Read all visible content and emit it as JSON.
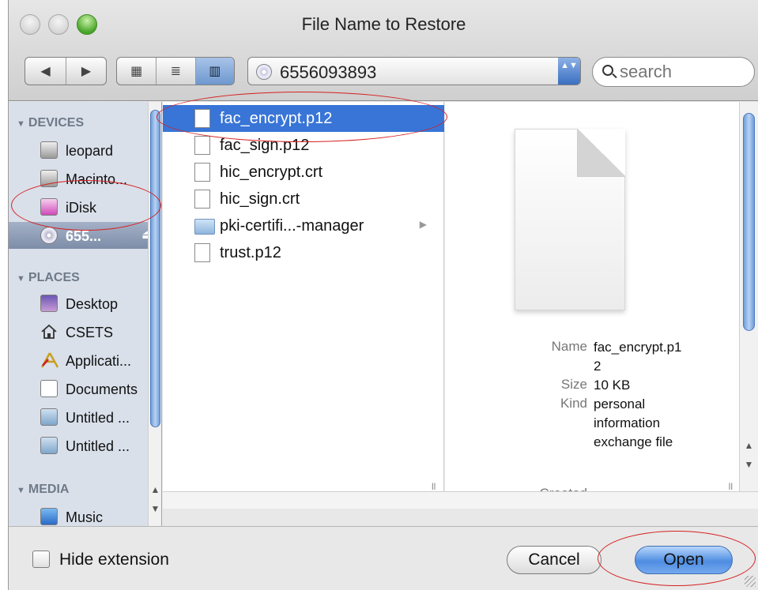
{
  "window": {
    "title": "File Name to Restore"
  },
  "toolbar": {
    "back_glyph": "◀",
    "forward_glyph": "▶",
    "view_icon_glyph": "▦",
    "view_list_glyph": "≣",
    "view_column_glyph": "▥",
    "path_value": "6556093893",
    "popup_arrows": "▲▼",
    "search_placeholder": "search"
  },
  "sidebar": {
    "devices_label": "DEVICES",
    "places_label": "PLACES",
    "media_label": "MEDIA",
    "devices": [
      {
        "label": "leopard",
        "icon": "hard-drive-icon"
      },
      {
        "label": "Macinto...",
        "icon": "hard-drive-icon"
      },
      {
        "label": "iDisk",
        "icon": "idisk-icon"
      },
      {
        "label": "655...",
        "icon": "cd-icon",
        "eject": "⏏"
      }
    ],
    "places": [
      {
        "label": "Desktop",
        "icon": "desktop-icon"
      },
      {
        "label": "CSETS",
        "icon": "home-icon"
      },
      {
        "label": "Applicati...",
        "icon": "applications-icon"
      },
      {
        "label": "Documents",
        "icon": "documents-icon"
      },
      {
        "label": "Untitled ...",
        "icon": "volume-icon"
      },
      {
        "label": "Untitled ...",
        "icon": "volume-icon"
      }
    ],
    "media": [
      {
        "label": "Music",
        "icon": "music-icon"
      }
    ]
  },
  "files": [
    {
      "label": "fac_encrypt.p12",
      "kind": "file",
      "selected": true
    },
    {
      "label": "fac_sign.p12",
      "kind": "file"
    },
    {
      "label": "hic_encrypt.crt",
      "kind": "file"
    },
    {
      "label": "hic_sign.crt",
      "kind": "file"
    },
    {
      "label": "pki-certifi...-manager",
      "kind": "folder",
      "more": "▶"
    },
    {
      "label": "trust.p12",
      "kind": "file"
    }
  ],
  "preview": {
    "name_key": "Name",
    "name_line1": "fac_encrypt.p1",
    "name_line2": "2",
    "size_key": "Size",
    "size_value": "10 KB",
    "kind_key": "Kind",
    "kind_line1": "personal",
    "kind_line2": "information",
    "kind_line3": "exchange file",
    "created_key": "Created",
    "created_value": "-"
  },
  "footer": {
    "hide_extension_label": "Hide extension",
    "cancel_label": "Cancel",
    "open_label": "Open"
  },
  "colors": {
    "selection": "#3875d7",
    "sidebar_bg": "#d9e0ea",
    "annotation_ring": "#d62020"
  }
}
